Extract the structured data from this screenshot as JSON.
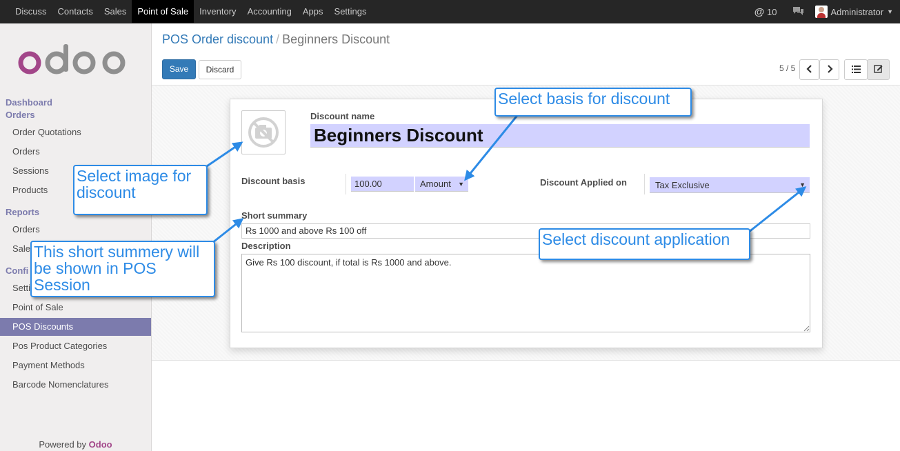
{
  "topbar": {
    "menu": [
      "Discuss",
      "Contacts",
      "Sales",
      "Point of Sale",
      "Inventory",
      "Accounting",
      "Apps",
      "Settings"
    ],
    "active": "Point of Sale",
    "mentions": "10",
    "user": "Administrator"
  },
  "sidebar": {
    "brand": "odoo",
    "dashboard": "Dashboard",
    "orders_head": "Orders",
    "orders_items": [
      "Order Quotations",
      "Orders",
      "Sessions",
      "Products"
    ],
    "reports_head": "Reports",
    "reports_items": [
      "Orders",
      "Sale"
    ],
    "config_head": "Confi",
    "config_items": [
      "Setti",
      "Point of Sale",
      "POS Discounts",
      "Pos Product Categories",
      "Payment Methods",
      "Barcode Nomenclatures"
    ],
    "active_item": "POS Discounts",
    "powered_prefix": "Powered by ",
    "powered_brand": "Odoo"
  },
  "breadcrumb": {
    "parent": "POS Order discount",
    "sep": "/",
    "current": "Beginners Discount"
  },
  "buttons": {
    "save": "Save",
    "discard": "Discard"
  },
  "pager": {
    "text": "5 / 5"
  },
  "form": {
    "name_label": "Discount name",
    "name_value": "Beginners Discount",
    "basis_label": "Discount basis",
    "basis_value": "100.00",
    "basis_type": "Amount",
    "applied_label": "Discount Applied on",
    "applied_value": "Tax Exclusive",
    "summary_label": "Short summary",
    "summary_value": "Rs 1000 and above Rs 100 off",
    "description_label": "Description",
    "description_value": "Give Rs 100 discount, if total is Rs 1000 and above."
  },
  "callouts": {
    "image": "Select image for discount",
    "basis": "Select basis for discount",
    "summary": "This short summery will be shown in POS Session",
    "application": "Select discount application"
  },
  "colors": {
    "accent": "#7c7bad",
    "primary": "#337ab7",
    "callout": "#2d8be6",
    "field": "#d2d2ff"
  }
}
